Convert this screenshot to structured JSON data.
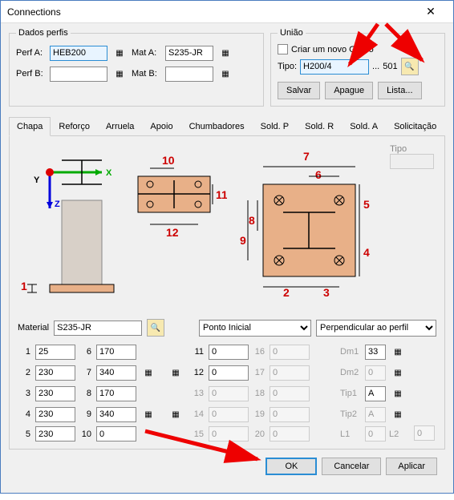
{
  "window": {
    "title": "Connections"
  },
  "dados": {
    "legend": "Dados perfis",
    "perfA_label": "Perf A:",
    "perfA_value": "HEB200",
    "perfB_label": "Perf B:",
    "perfB_value": "",
    "matA_label": "Mat A:",
    "matA_value": "S235-JR",
    "matB_label": "Mat B:",
    "matB_value": ""
  },
  "uniao": {
    "legend": "União",
    "check_label": "Criar um novo Grupo",
    "tipo_label": "Tipo:",
    "tipo_value": "H200/4",
    "tipo_num": "501",
    "salvar": "Salvar",
    "apague": "Apague",
    "lista": "Lista..."
  },
  "tabs": [
    "Chapa",
    "Reforço",
    "Arruela",
    "Apoio",
    "Chumbadores",
    "Sold. P",
    "Sold. R",
    "Sold. A",
    "Solicitação"
  ],
  "tipo_side": {
    "label": "Tipo"
  },
  "material": {
    "label": "Material",
    "value": "S235-JR",
    "sel1": "Ponto Inicial",
    "sel2": "Perpendicular ao perfil"
  },
  "params": {
    "1": "25",
    "2": "230",
    "3": "230",
    "4": "230",
    "5": "230",
    "6": "170",
    "7": "340",
    "8": "170",
    "9": "340",
    "10": "0",
    "11": "0",
    "12": "0",
    "13": "0",
    "14": "0",
    "15": "0",
    "16": "0",
    "17": "0",
    "18": "0",
    "19": "0",
    "20": "0",
    "Dm1_label": "Dm1",
    "Dm1": "33",
    "Dm2_label": "Dm2",
    "Dm2": "0",
    "Tip1_label": "Tip1",
    "Tip1": "A",
    "Tip2_label": "Tip2",
    "Tip2": "A",
    "L1_label": "L1",
    "L1": "0",
    "L2_label": "L2",
    "L2": "0"
  },
  "footer": {
    "ok": "OK",
    "cancel": "Cancelar",
    "apply": "Aplicar"
  },
  "dims": {
    "d1": "1",
    "d2": "2",
    "d3": "3",
    "d4": "4",
    "d5": "5",
    "d6": "6",
    "d7": "7",
    "d8": "8",
    "d9": "9",
    "d10": "10",
    "d11": "11",
    "d12": "12"
  },
  "axes": {
    "x": "X",
    "y": "Y",
    "z": "Z"
  }
}
